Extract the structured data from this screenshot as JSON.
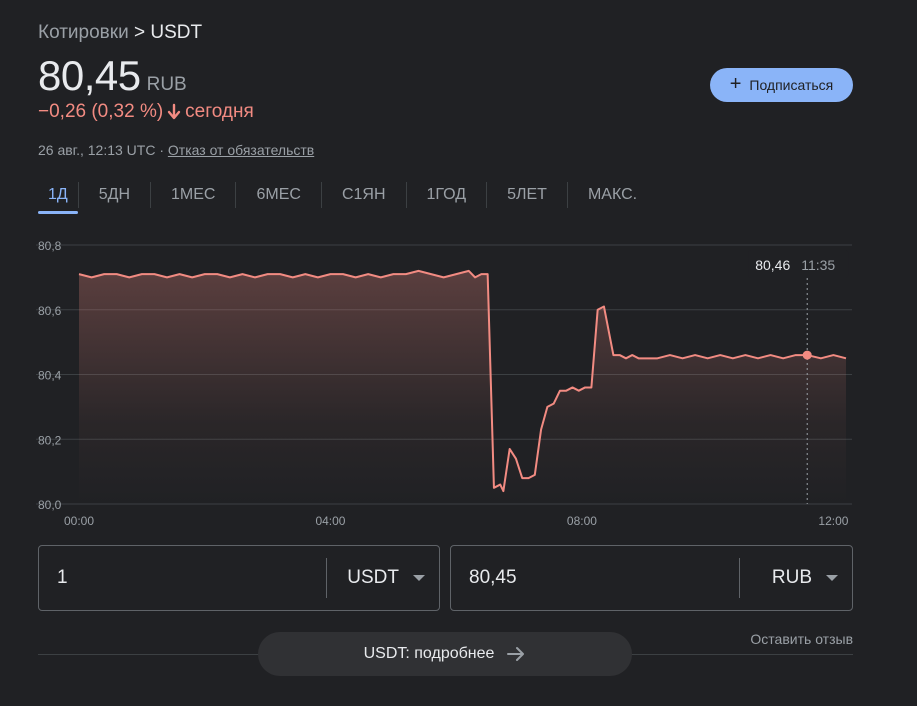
{
  "breadcrumb": {
    "parent": "Котировки",
    "separator": ">",
    "current": "USDT"
  },
  "price": {
    "value": "80,45",
    "currency": "RUB"
  },
  "change": {
    "text": "−0,26 (0,32 %)",
    "period": "сегодня",
    "color": "#f28b82"
  },
  "meta": {
    "timestamp": "26 авг., 12:13 UTC ·",
    "disclaimer": "Отказ от обязательств"
  },
  "subscribe": {
    "icon": "plus-icon",
    "label": "Подписаться"
  },
  "tabs": [
    {
      "label": "1Д",
      "active": true
    },
    {
      "label": "5ДН"
    },
    {
      "label": "1МЕС"
    },
    {
      "label": "6МЕС"
    },
    {
      "label": "С1ЯН"
    },
    {
      "label": "1ГОД"
    },
    {
      "label": "5ЛЕТ"
    },
    {
      "label": "МАКС."
    }
  ],
  "tooltip": {
    "value": "80,46",
    "time": "11:35"
  },
  "converter": {
    "from": {
      "amount": "1",
      "currency": "USDT"
    },
    "to": {
      "amount": "80,45",
      "currency": "RUB"
    }
  },
  "feedback": "Оставить отзыв",
  "more_button": "USDT: подробнее",
  "chart_data": {
    "type": "area",
    "series": [
      {
        "x": [
          0.0,
          0.2,
          0.4,
          0.6,
          0.8,
          1.0,
          1.2,
          1.4,
          1.6,
          1.8,
          2.0,
          2.2,
          2.4,
          2.6,
          2.8,
          3.0,
          3.2,
          3.4,
          3.6,
          3.8,
          4.0,
          4.2,
          4.4,
          4.6,
          4.8,
          5.0,
          5.2,
          5.4,
          5.6,
          5.8,
          6.0,
          6.2,
          6.3,
          6.4,
          6.5,
          6.6,
          6.7,
          6.75,
          6.85,
          6.95,
          7.05,
          7.15,
          7.25,
          7.35,
          7.45,
          7.55,
          7.65,
          7.75,
          7.85,
          7.95,
          8.05,
          8.15,
          8.25,
          8.35,
          8.5,
          8.6,
          8.7,
          8.8,
          8.9,
          9.0,
          9.2,
          9.4,
          9.6,
          9.8,
          10.0,
          10.2,
          10.4,
          10.6,
          10.8,
          11.0,
          11.2,
          11.4,
          11.583,
          11.8,
          12.0,
          12.2
        ],
        "y": [
          80.71,
          80.7,
          80.71,
          80.71,
          80.7,
          80.71,
          80.71,
          80.7,
          80.71,
          80.7,
          80.71,
          80.71,
          80.7,
          80.71,
          80.7,
          80.71,
          80.71,
          80.7,
          80.71,
          80.7,
          80.71,
          80.71,
          80.7,
          80.71,
          80.7,
          80.71,
          80.71,
          80.72,
          80.71,
          80.7,
          80.71,
          80.72,
          80.7,
          80.71,
          80.71,
          80.05,
          80.06,
          80.04,
          80.17,
          80.14,
          80.08,
          80.08,
          80.09,
          80.23,
          80.3,
          80.31,
          80.35,
          80.35,
          80.36,
          80.35,
          80.36,
          80.36,
          80.6,
          80.61,
          80.46,
          80.46,
          80.45,
          80.46,
          80.45,
          80.45,
          80.45,
          80.46,
          80.45,
          80.46,
          80.45,
          80.46,
          80.45,
          80.46,
          80.45,
          80.46,
          80.45,
          80.46,
          80.46,
          80.45,
          80.46,
          80.45
        ]
      }
    ],
    "y_ticks": [
      "80,0",
      "80,2",
      "80,4",
      "80,6",
      "80,8"
    ],
    "x_ticks": [
      "00:00",
      "04:00",
      "08:00",
      "12:00"
    ],
    "ylim": [
      80.0,
      80.8
    ],
    "xlim": [
      0,
      12.2
    ],
    "grid": true,
    "highlight": {
      "x": 11.583,
      "y": 80.46
    },
    "line_color": "#f28b82"
  }
}
